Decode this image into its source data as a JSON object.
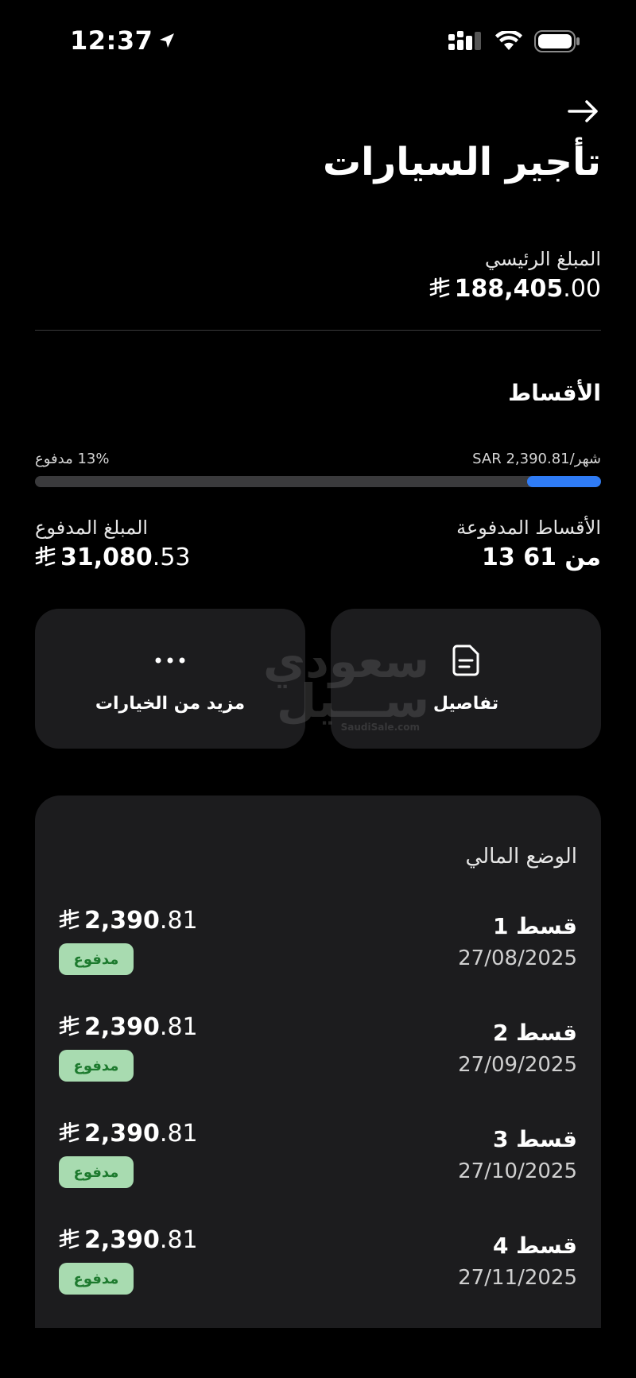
{
  "status": {
    "time": "12:37"
  },
  "page": {
    "title": "تأجير السيارات"
  },
  "principal": {
    "label": "المبلغ الرئيسي",
    "int": "188,405",
    "dec": ".00"
  },
  "installments_section": {
    "title": "الأقساط",
    "monthly": "SAR 2,390.81/شهر",
    "paid_pct_text": "13% مدفوع",
    "progress_fraction": 0.13
  },
  "paid_installments": {
    "label": "الأقساط المدفوعة",
    "value": "13 من 61"
  },
  "paid_amount": {
    "label": "المبلغ المدفوع",
    "int": "31,080",
    "dec": ".53"
  },
  "actions": {
    "details_label": "تفاصيل",
    "more_label": "مزيد من الخيارات"
  },
  "watermark": {
    "line1": "سعودي",
    "line2": "ســـيل",
    "sub": "SaudiSale.com"
  },
  "financial": {
    "title": "الوضع المالي",
    "items": [
      {
        "name": "قسط 1",
        "date": "27/08/2025",
        "int": "2,390",
        "dec": ".81",
        "status": "مدفوع"
      },
      {
        "name": "قسط 2",
        "date": "27/09/2025",
        "int": "2,390",
        "dec": ".81",
        "status": "مدفوع"
      },
      {
        "name": "قسط 3",
        "date": "27/10/2025",
        "int": "2,390",
        "dec": ".81",
        "status": "مدفوع"
      },
      {
        "name": "قسط 4",
        "date": "27/11/2025",
        "int": "2,390",
        "dec": ".81",
        "status": "مدفوع"
      }
    ]
  },
  "colors": {
    "accent": "#2f7cf6",
    "card": "#1c1c1e",
    "badge_bg": "#a8dbb0",
    "badge_text": "#1d7a2e"
  }
}
